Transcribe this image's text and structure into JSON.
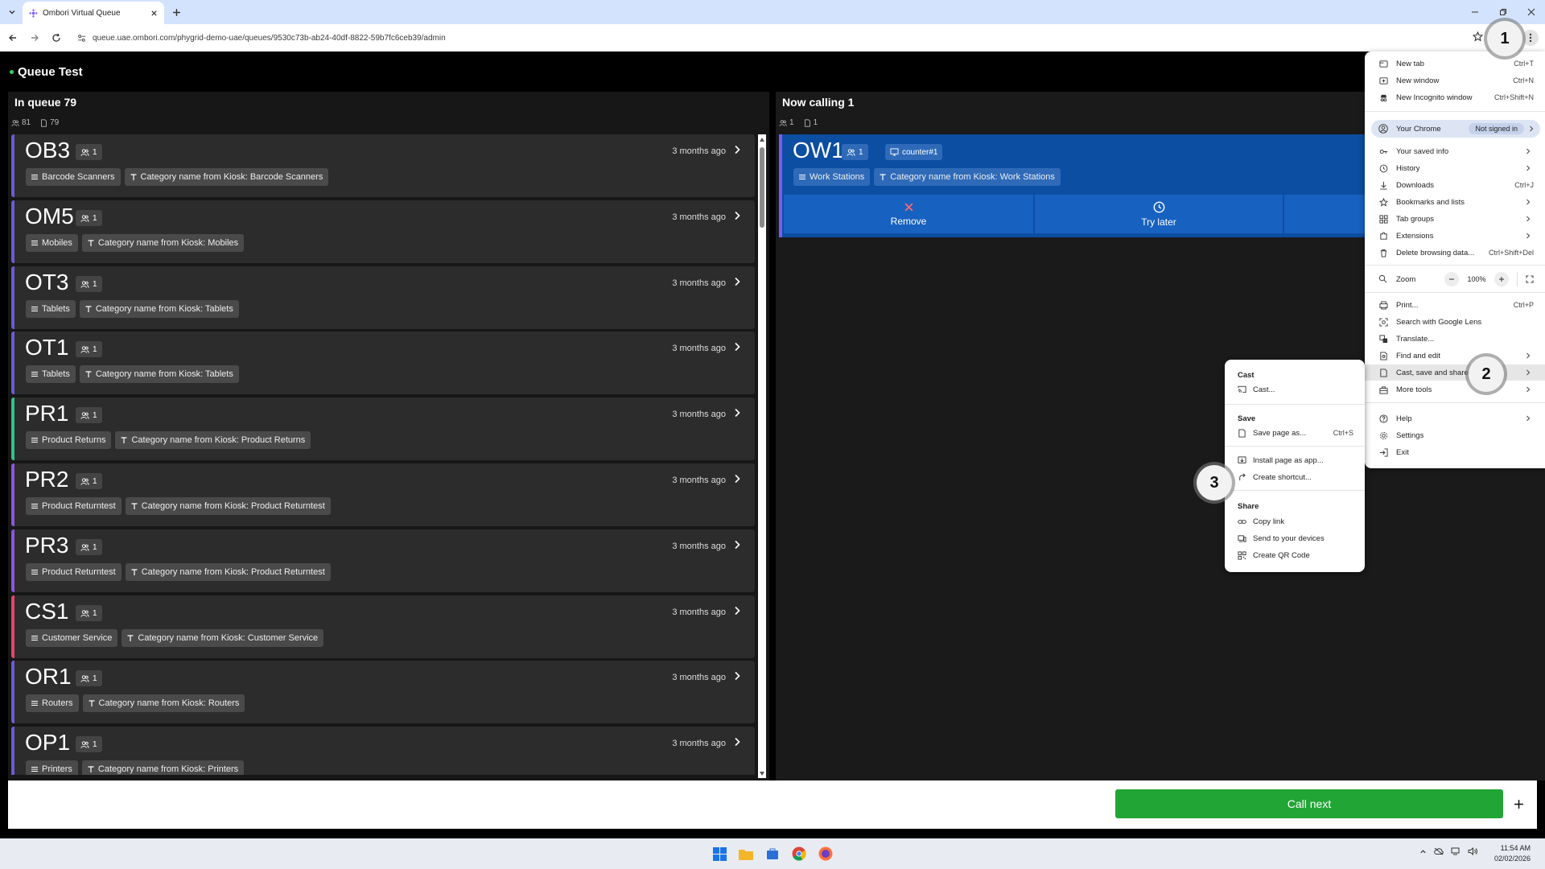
{
  "browser": {
    "tab_title": "Ombori Virtual Queue",
    "url": "queue.uae.ombori.com/phygrid-demo-uae/queues/9530c73b-ab24-40df-8822-59b7fc6ceb39/admin"
  },
  "app": {
    "title": "Queue Test",
    "status_color": "#3ecf5a"
  },
  "queue_panel": {
    "title": "In queue 79",
    "stat_people": "81",
    "stat_tickets": "79",
    "tickets": [
      {
        "code": "OB3",
        "people": "1",
        "time": "3 months ago",
        "color": "#6b5bd6",
        "tags": [
          "Barcode Scanners",
          "Category name from Kiosk: Barcode Scanners"
        ]
      },
      {
        "code": "OM5",
        "people": "1",
        "time": "3 months ago",
        "color": "#6b5bd6",
        "tags": [
          "Mobiles",
          "Category name from Kiosk: Mobiles"
        ]
      },
      {
        "code": "OT3",
        "people": "1",
        "time": "3 months ago",
        "color": "#6b5bd6",
        "tags": [
          "Tablets",
          "Category name from Kiosk: Tablets"
        ]
      },
      {
        "code": "OT1",
        "people": "1",
        "time": "3 months ago",
        "color": "#6b5bd6",
        "tags": [
          "Tablets",
          "Category name from Kiosk: Tablets"
        ]
      },
      {
        "code": "PR1",
        "people": "1",
        "time": "3 months ago",
        "color": "#35c08a",
        "tags": [
          "Product Returns",
          "Category name from Kiosk: Product Returns"
        ]
      },
      {
        "code": "PR2",
        "people": "1",
        "time": "3 months ago",
        "color": "#8b56e0",
        "tags": [
          "Product Returntest",
          "Category name from Kiosk: Product Returntest"
        ]
      },
      {
        "code": "PR3",
        "people": "1",
        "time": "3 months ago",
        "color": "#8b56e0",
        "tags": [
          "Product Returntest",
          "Category name from Kiosk: Product Returntest"
        ]
      },
      {
        "code": "CS1",
        "people": "1",
        "time": "3 months ago",
        "color": "#e0466a",
        "tags": [
          "Customer Service",
          "Category name from Kiosk: Customer Service"
        ]
      },
      {
        "code": "OR1",
        "people": "1",
        "time": "3 months ago",
        "color": "#6b5bd6",
        "tags": [
          "Routers",
          "Category name from Kiosk: Routers"
        ]
      },
      {
        "code": "OP1",
        "people": "1",
        "time": "3 months ago",
        "color": "#6b5bd6",
        "tags": [
          "Printers",
          "Category name from Kiosk: Printers"
        ]
      }
    ]
  },
  "calling_panel": {
    "title": "Now calling 1",
    "stat_people": "1",
    "stat_tickets": "1",
    "ticket": {
      "code": "OW1",
      "people": "1",
      "counter": "counter#1",
      "tags": [
        "Work Stations",
        "Category name from Kiosk: Work Stations"
      ],
      "remove_label": "Remove",
      "try_later_label": "Try later"
    }
  },
  "footer": {
    "call_next_label": "Call next",
    "call_next_color": "#21a535"
  },
  "chrome_menu": {
    "new_tab": {
      "label": "New tab",
      "shortcut": "Ctrl+T"
    },
    "new_window": {
      "label": "New window",
      "shortcut": "Ctrl+N"
    },
    "new_incognito": {
      "label": "New Incognito window",
      "shortcut": "Ctrl+Shift+N"
    },
    "profile": {
      "label": "Your Chrome",
      "badge": "Not signed in"
    },
    "saved_info": {
      "label": "Your saved info"
    },
    "history": {
      "label": "History"
    },
    "downloads": {
      "label": "Downloads",
      "shortcut": "Ctrl+J"
    },
    "bookmarks": {
      "label": "Bookmarks and lists"
    },
    "tab_groups": {
      "label": "Tab groups"
    },
    "extensions": {
      "label": "Extensions"
    },
    "delete_data": {
      "label": "Delete browsing data...",
      "shortcut": "Ctrl+Shift+Del"
    },
    "zoom": {
      "label": "Zoom",
      "value": "100%"
    },
    "print": {
      "label": "Print...",
      "shortcut": "Ctrl+P"
    },
    "google_lens": {
      "label": "Search with Google Lens"
    },
    "translate": {
      "label": "Translate..."
    },
    "find_edit": {
      "label": "Find and edit"
    },
    "cast_save_share": {
      "label": "Cast, save and share"
    },
    "more_tools": {
      "label": "More tools"
    },
    "help": {
      "label": "Help"
    },
    "settings": {
      "label": "Settings"
    },
    "exit": {
      "label": "Exit"
    }
  },
  "submenu": {
    "cast_heading": "Cast",
    "cast_item": "Cast...",
    "save_heading": "Save",
    "save_page": {
      "label": "Save page as...",
      "shortcut": "Ctrl+S"
    },
    "install_app": "Install page as app...",
    "create_shortcut": "Create shortcut...",
    "share_heading": "Share",
    "copy_link": "Copy link",
    "send_devices": "Send to your devices",
    "qr_code": "Create QR Code"
  },
  "steps": [
    "1",
    "2",
    "3"
  ],
  "taskbar": {
    "time": "11:54 AM",
    "date": "02/02/2026"
  }
}
